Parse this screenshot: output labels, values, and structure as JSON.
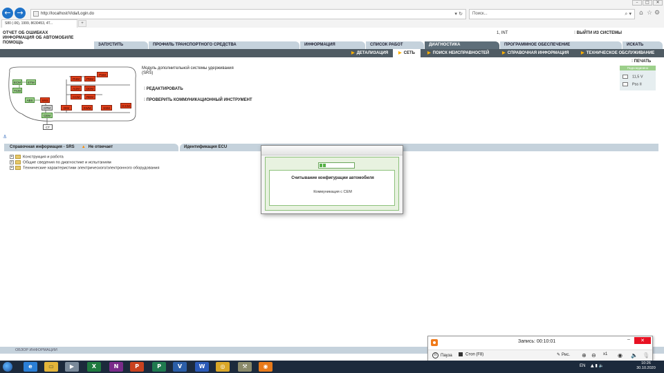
{
  "browser": {
    "url": "http://localhost/Vida/Login.do",
    "search_placeholder": "Поиск...",
    "tab_title": "S80 (-06), 1999, 8630453, 4T...",
    "back_icon": "←",
    "forward_icon": "→"
  },
  "header": {
    "links": [
      "ОТЧЕТ ОБ ОШИБКАХ",
      "ИНФОРМАЦИЯ ОБ АВТОМОБИЛЕ",
      "ПОМОЩЬ"
    ],
    "user": "1, INT",
    "logout": "ВЫЙТИ ИЗ СИСТЕМЫ"
  },
  "main_tabs": [
    "ЗАПУСТИТЬ",
    "ПРОФИЛЬ ТРАНСПОРТНОГО СРЕДСТВА",
    "ИНФОРМАЦИЯ",
    "СПИСОК РАБОТ",
    "ДИАГНОСТИКА",
    "ПРОГРАММНОЕ ОБЕСПЕЧЕНИЕ",
    "ИСКАТЬ"
  ],
  "sub_tabs": [
    "ДЕТАЛИЗАЦИЯ",
    "СЕТЬ",
    "ПОИСК НЕИСПРАВНОСТЕЙ",
    "СПРАВОЧНАЯ ИНФОРМАЦИЯ",
    "ТЕХНИЧЕСКОЕ ОБСЛУЖИВАНИЕ"
  ],
  "diagram_nodes": {
    "ecm": "ECM",
    "etm": "ETM",
    "tcm": "TCM",
    "abs": "ABS",
    "srs": "SRS",
    "cpm": "CPM",
    "cem": "CEM",
    "ct": "CT",
    "phm": "PHM",
    "pdm": "PDM",
    "aum": "AUM",
    "ccm": "CCM",
    "ddm": "DDM",
    "psm": "PSM",
    "rem": "REM",
    "iccm": "ICCM",
    "ssm": "SSM",
    "dim": "DIM",
    "swm": "SWM"
  },
  "module": {
    "title": "Модуль дополнительной системы удерживания (SRS)",
    "edit": "РЕДАКТИРОВАТЬ",
    "verify": "ПРОВЕРИТЬ КОММУНИКАЦИОННЫЙ ИНСТРУМЕНТ"
  },
  "print": "ПЕЧАТЬ",
  "status": {
    "header": "Подсоединено",
    "voltage": "11,5 V",
    "device": "Pss II"
  },
  "left_panel": {
    "title": "Справочная информация - SRS",
    "status": "Не отвечает",
    "items": [
      "Конструкция и работа",
      "Общие сведения по диагностике и испытаниям",
      "Технические характеристики электрического/электронного оборудования"
    ]
  },
  "right_panel": {
    "title": "Идентификация ECU"
  },
  "footer": "ОБЗОР ИНФОРМАЦИИ",
  "modal": {
    "title": "Считывание конфигурации автомобиля",
    "message": "Коммуникация с CEM",
    "progress": 0.22
  },
  "recorder": {
    "time": "Запись:  00:10:01",
    "pause": "Пауза",
    "stop": "Стоп (F8)",
    "draw": "Рис.",
    "zoom": "x1"
  },
  "taskbar": {
    "lang": "EN",
    "time": "10:26",
    "date": "30.10.2020"
  }
}
